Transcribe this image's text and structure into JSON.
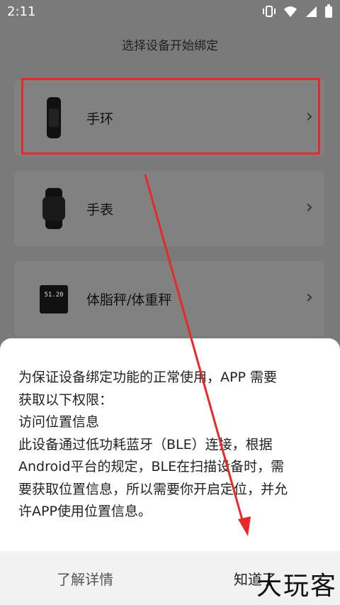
{
  "status": {
    "time": "2:11"
  },
  "header": {
    "title": "选择设备开始绑定"
  },
  "devices": [
    {
      "label": "手环",
      "icon": "band-icon"
    },
    {
      "label": "手表",
      "icon": "watch-icon"
    },
    {
      "label": "体脂秤/体重秤",
      "icon": "scale-icon"
    }
  ],
  "scale_display": "51.20",
  "dialog": {
    "lines": [
      "为保证设备绑定功能的正常使用，APP 需要",
      "获取以下权限：",
      "访问位置信息",
      "此设备通过低功耗蓝牙（BLE）连接，根据",
      "Android平台的规定，BLE在扫描设备时，需",
      "要获取位置信息，所以需要你开启定位，并允",
      "许APP使用位置信息。"
    ],
    "learn_more": "了解详情",
    "got_it": "知道了"
  },
  "watermark": "大玩客",
  "colors": {
    "highlight": "#e8292b",
    "arrow": "#e8292b"
  }
}
